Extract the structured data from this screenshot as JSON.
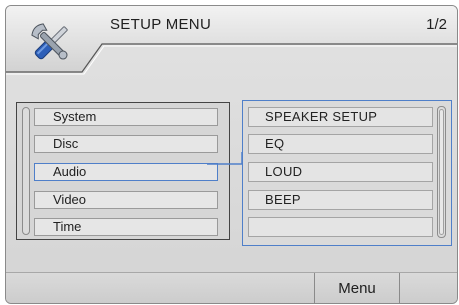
{
  "header": {
    "title": "SETUP MENU",
    "page_indicator": "1/2",
    "icon": "tools-icon"
  },
  "left_menu": {
    "items": [
      {
        "label": "System"
      },
      {
        "label": "Disc"
      },
      {
        "label": "Audio"
      },
      {
        "label": "Video"
      },
      {
        "label": "Time"
      }
    ],
    "selected": "Audio"
  },
  "submenu": {
    "items": [
      {
        "label": "SPEAKER SETUP"
      },
      {
        "label": "EQ"
      },
      {
        "label": "LOUD"
      },
      {
        "label": "BEEP"
      },
      {
        "label": ""
      }
    ]
  },
  "footer": {
    "menu_label": "Menu"
  },
  "colors": {
    "selection_outline": "#4f7fc9",
    "panel_border": "#444444",
    "background": "#d6d6d6"
  }
}
